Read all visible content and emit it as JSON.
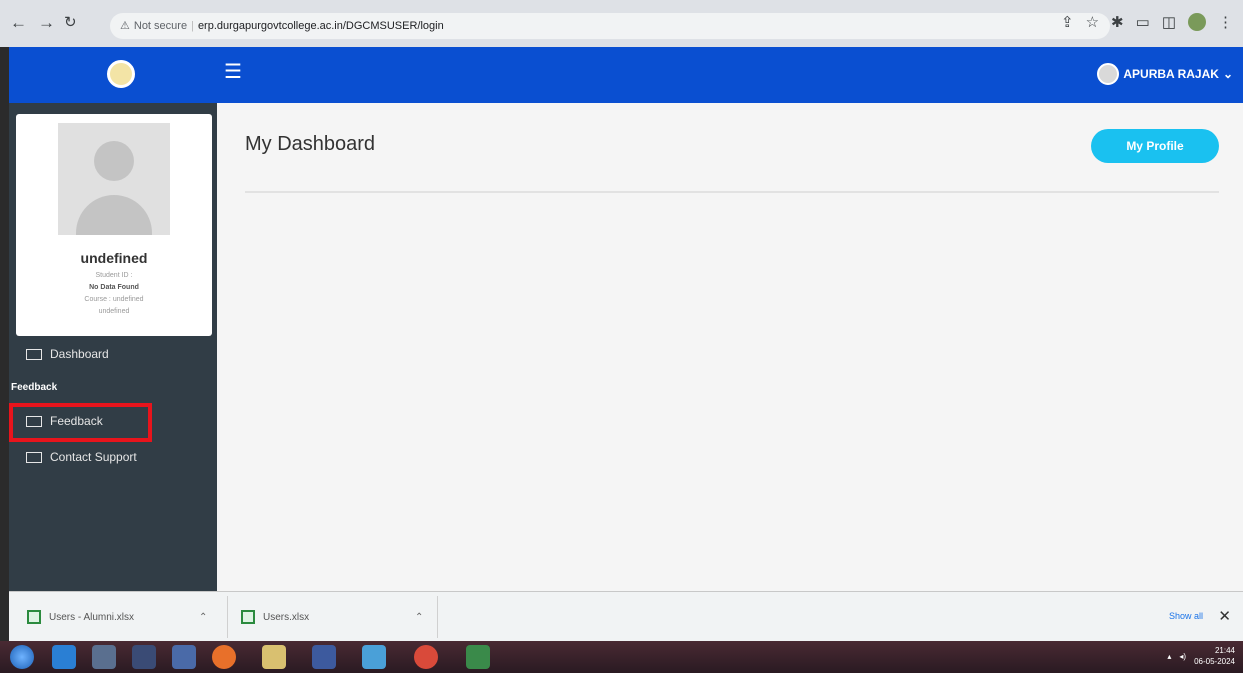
{
  "browser": {
    "security_label": "Not secure",
    "url": "erp.durgapurgovtcollege.ac.in/DGCMSUSER/login"
  },
  "header": {
    "user_name": "APURBA RAJAK"
  },
  "profile": {
    "name": "undefined",
    "student_id": "Student ID :",
    "no_data": "No Data Found",
    "course": "Course : undefined",
    "course_value": "undefined"
  },
  "sidebar": {
    "items": [
      {
        "label": "Dashboard"
      },
      {
        "label": "Feedback"
      },
      {
        "label": "Contact Support"
      }
    ],
    "section_heading": "Feedback"
  },
  "main": {
    "title": "My Dashboard",
    "profile_button": "My Profile"
  },
  "downloads": {
    "items": [
      {
        "name": "Users - Alumni.xlsx"
      },
      {
        "name": "Users.xlsx"
      }
    ],
    "show_all": "Show all"
  },
  "taskbar": {
    "time": "21:44",
    "date": "06-05-2024"
  },
  "colors": {
    "header_blue": "#0a4fd1",
    "sidebar_dark": "#313d46",
    "accent_cyan": "#1ac1f0",
    "highlight_red": "#e8141c"
  }
}
